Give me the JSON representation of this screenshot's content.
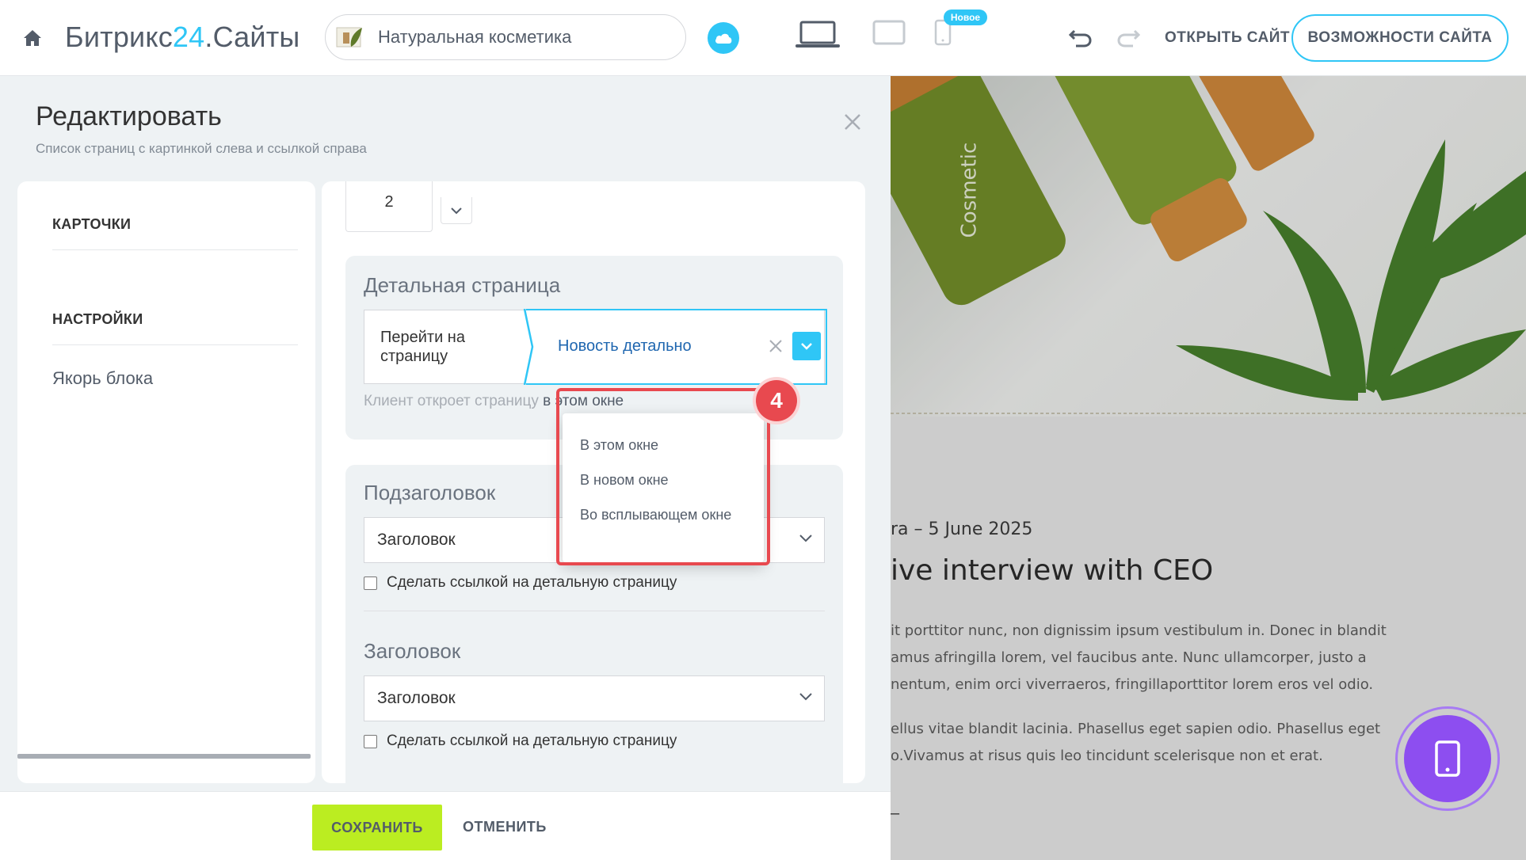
{
  "header": {
    "brand_main": "Битрикс",
    "brand_accent": "24",
    "brand_suffix": ".Сайты",
    "site_name": "Натуральная косметика",
    "new_badge": "Новое",
    "open_site": "ОТКРЫТЬ САЙТ",
    "features_button": "ВОЗМОЖНОСТИ САЙТА",
    "accent_color": "#2fc6f6"
  },
  "editor": {
    "title": "Редактировать",
    "subtitle": "Список страниц с картинкой слева и ссылкой справа",
    "nav": {
      "cards": "КАРТОЧКИ",
      "settings": "НАСТРОЙКИ",
      "anchor": "Якорь блока"
    },
    "count_value": "2",
    "detail_section": {
      "title": "Детальная страница",
      "link_label": "Перейти на страницу",
      "link_value": "Новость детально",
      "hint_prefix": "Клиент откроет страницу",
      "hint_value": "в этом окне"
    },
    "subtitle_section": {
      "title": "Подзаголовок",
      "select_value": "Заголовок",
      "checkbox_label": "Сделать ссылкой на детальную страницу"
    },
    "heading_section": {
      "title": "Заголовок",
      "select_value": "Заголовок",
      "checkbox_label": "Сделать ссылкой на детальную страницу"
    },
    "save": "СОХРАНИТЬ",
    "cancel": "ОТМЕНИТЬ",
    "save_color": "#bbed21"
  },
  "popup": {
    "options": [
      "В этом окне",
      "В новом окне",
      "Во всплывающем окне"
    ],
    "step_number": "4",
    "highlight_color": "#e8494f"
  },
  "preview": {
    "meta": "ra  –  5 June 2025",
    "headline": "ive interview with CEO",
    "paragraph1": [
      "it porttitor nunc, non dignissim ipsum vestibulum in. Donec in blandit",
      "amus afringilla lorem, vel faucibus ante. Nunc ullamcorper, justo a",
      "nentum, enim orci viverraeros, fringillaporttitor lorem eros vel odio."
    ],
    "paragraph2": [
      "ellus vitae blandit lacinia. Phasellus eget sapien odio. Phasellus eget",
      "o.Vivamus at risus quis leo tincidunt scelerisque non et erat."
    ],
    "dash": "–",
    "fab_color": "#8d4ef0"
  }
}
